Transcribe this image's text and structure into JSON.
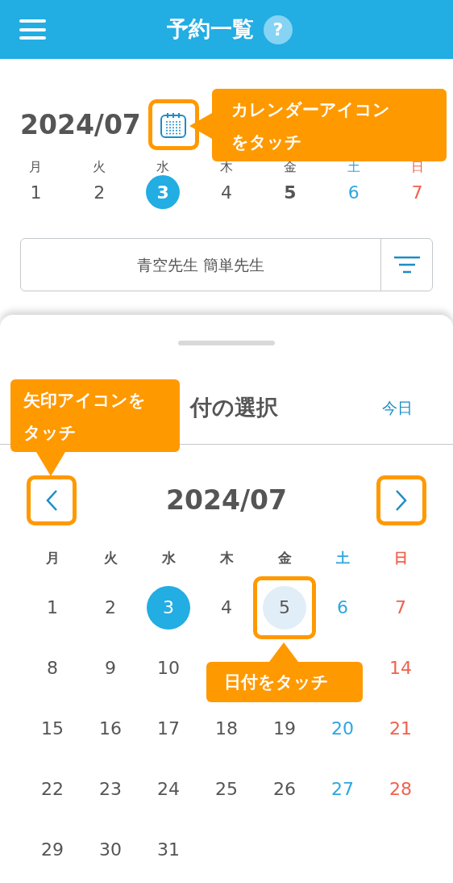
{
  "header": {
    "title": "予約一覧",
    "help": "?"
  },
  "week_strip": {
    "month": "2024/07",
    "weekdays": [
      "月",
      "火",
      "水",
      "木",
      "金",
      "土",
      "日"
    ],
    "days": [
      {
        "text": "1",
        "selected": false,
        "today": false
      },
      {
        "text": "2",
        "selected": false,
        "today": false
      },
      {
        "text": "3",
        "selected": true,
        "today": false
      },
      {
        "text": "4",
        "selected": false,
        "today": false
      },
      {
        "text": "5",
        "selected": false,
        "today": true
      },
      {
        "text": "6",
        "selected": false,
        "today": false
      },
      {
        "text": "7",
        "selected": false,
        "today": false
      }
    ]
  },
  "teacher_filter": {
    "value": "青空先生 簡単先生"
  },
  "date_sheet": {
    "title": "付の選択",
    "today_button": "今日",
    "month": "2024/07",
    "weekdays": [
      "月",
      "火",
      "水",
      "木",
      "金",
      "土",
      "日"
    ],
    "weeks": [
      {
        "mon": {
          "text": "1",
          "selected": false,
          "today": false
        },
        "tue": {
          "text": "2",
          "selected": false,
          "today": false
        },
        "wed": {
          "text": "3",
          "selected": true,
          "today": false
        },
        "thu": {
          "text": "4",
          "selected": false,
          "today": false
        },
        "fri": {
          "text": "5",
          "selected": false,
          "today": true
        },
        "sat": {
          "text": "6",
          "selected": false,
          "today": false
        },
        "sun": {
          "text": "7",
          "selected": false,
          "today": false
        }
      },
      {
        "mon": {
          "text": "8",
          "selected": false,
          "today": false
        },
        "tue": {
          "text": "9",
          "selected": false,
          "today": false
        },
        "wed": {
          "text": "10",
          "selected": false,
          "today": false
        },
        "sun": {
          "text": "14",
          "selected": false,
          "today": false
        }
      },
      {
        "mon": {
          "text": "15",
          "selected": false,
          "today": false
        },
        "tue": {
          "text": "16",
          "selected": false,
          "today": false
        },
        "wed": {
          "text": "17",
          "selected": false,
          "today": false
        },
        "thu": {
          "text": "18",
          "selected": false,
          "today": false
        },
        "fri": {
          "text": "19",
          "selected": false,
          "today": false
        },
        "sat": {
          "text": "20",
          "selected": false,
          "today": false
        },
        "sun": {
          "text": "21",
          "selected": false,
          "today": false
        }
      },
      {
        "mon": {
          "text": "22",
          "selected": false,
          "today": false
        },
        "tue": {
          "text": "23",
          "selected": false,
          "today": false
        },
        "wed": {
          "text": "24",
          "selected": false,
          "today": false
        },
        "thu": {
          "text": "25",
          "selected": false,
          "today": false
        },
        "fri": {
          "text": "26",
          "selected": false,
          "today": false
        },
        "sat": {
          "text": "27",
          "selected": false,
          "today": false
        },
        "sun": {
          "text": "28",
          "selected": false,
          "today": false
        }
      },
      {
        "mon": {
          "text": "29",
          "selected": false,
          "today": false
        },
        "tue": {
          "text": "30",
          "selected": false,
          "today": false
        },
        "wed": {
          "text": "31",
          "selected": false,
          "today": false
        }
      }
    ]
  },
  "callouts": [
    {
      "kind": "left",
      "text": "カレンダーアイコンをタッチ"
    },
    {
      "kind": "down",
      "text": "矢印アイコンをタッチ"
    },
    {
      "kind": "up",
      "text": "日付をタッチ"
    }
  ]
}
